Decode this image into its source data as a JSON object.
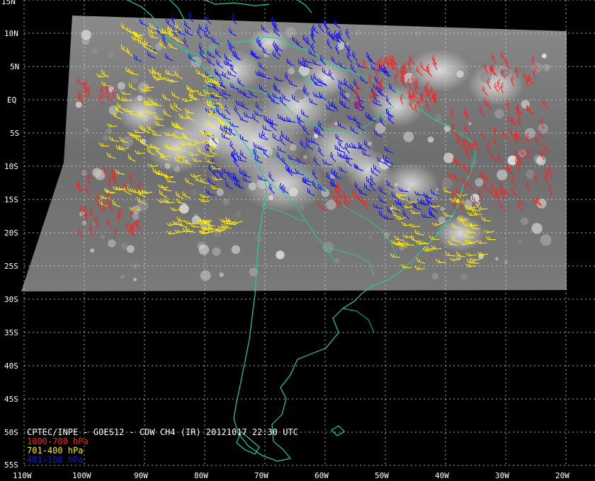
{
  "title": "CPTEC/INPE - GOES12 - CDW CH4 (IR) 20121017 22:30 UTC",
  "legend": [
    {
      "label": "1000-700 hPa",
      "color": "#ff2020"
    },
    {
      "label": "701-400 hPa",
      "color": "#ffee00"
    },
    {
      "label": "401-100 hPa",
      "color": "#1010ff"
    }
  ],
  "axes": {
    "lat_labels": [
      "15N",
      "10N",
      "5N",
      "EQ",
      "5S",
      "10S",
      "15S",
      "20S",
      "25S",
      "30S",
      "35S",
      "40S",
      "45S",
      "50S",
      "55S"
    ],
    "lon_labels": [
      "110W",
      "100W",
      "90W",
      "80W",
      "70W",
      "60W",
      "50W",
      "40W",
      "30W",
      "20W"
    ]
  },
  "colors": {
    "coast": "#20d0a0",
    "grid": "#d8d8d8",
    "background": "#000000"
  }
}
